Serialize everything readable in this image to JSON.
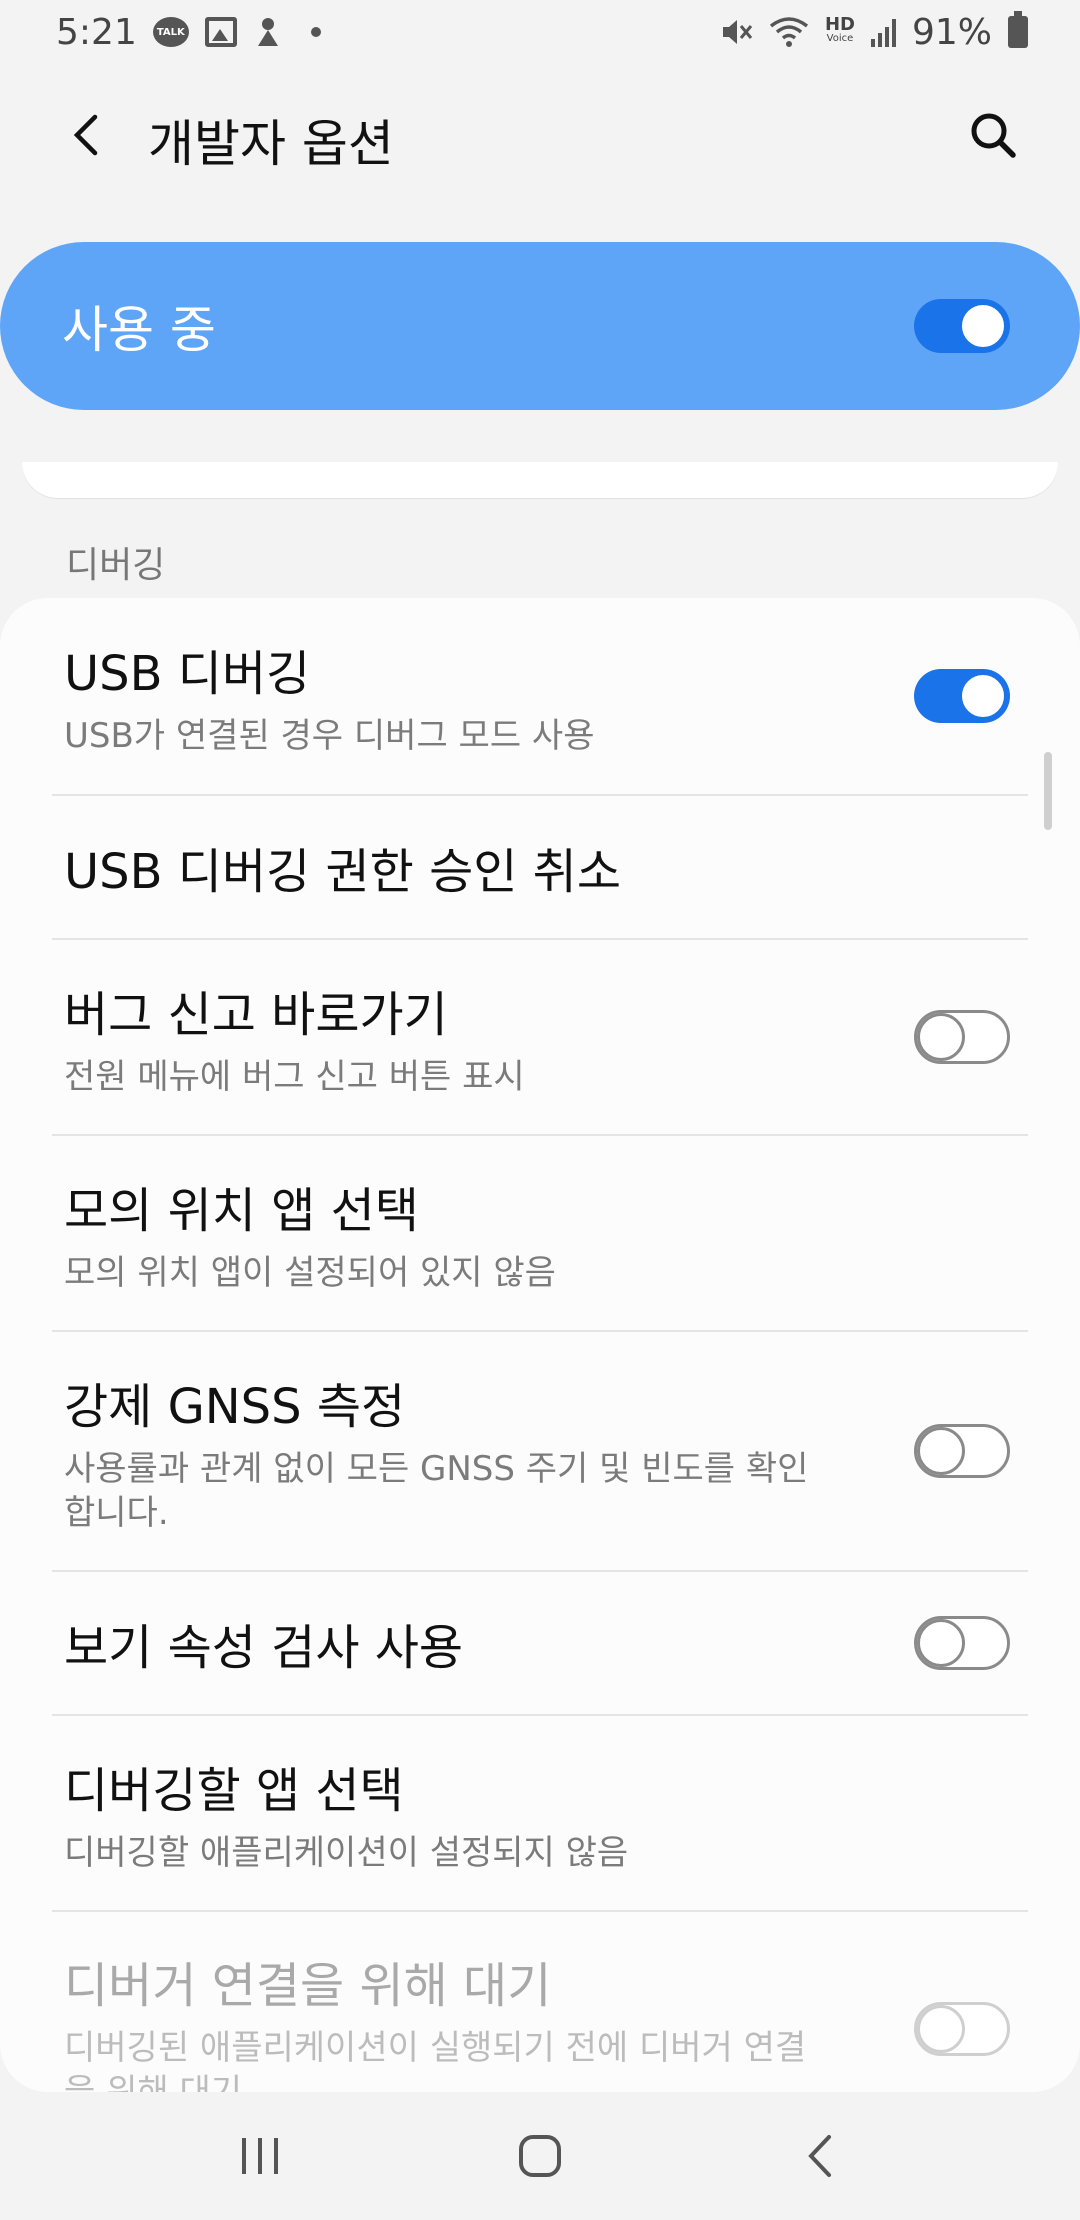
{
  "status_bar": {
    "time": "5:21",
    "talk_label": "TALK",
    "hd_label_top": "HD",
    "hd_label_bottom": "Voice",
    "battery": "91%",
    "icons": [
      "kakaotalk-icon",
      "gallery-icon",
      "download-icon",
      "dot-icon",
      "mute-icon",
      "wifi-icon",
      "hd-voice-icon",
      "signal-icon",
      "battery-icon"
    ]
  },
  "header": {
    "title": "개발자 옵션",
    "back_icon": "chevron-left-icon",
    "search_icon": "search-icon"
  },
  "master": {
    "label": "사용 중",
    "enabled": true
  },
  "section": {
    "title": "디버깅"
  },
  "settings": [
    {
      "title": "USB 디버깅",
      "summary": "USB가 연결된 경우 디버그 모드 사용",
      "toggle": "on"
    },
    {
      "title": "USB 디버깅 권한 승인 취소",
      "summary": "",
      "toggle": "none"
    },
    {
      "title": "버그 신고 바로가기",
      "summary": "전원 메뉴에 버그 신고 버튼 표시",
      "toggle": "off"
    },
    {
      "title": "모의 위치 앱 선택",
      "summary": "모의 위치 앱이 설정되어 있지 않음",
      "toggle": "none"
    },
    {
      "title": "강제 GNSS 측정",
      "summary": "사용률과 관계 없이 모든 GNSS 주기 및 빈도를 확인합니다.",
      "toggle": "off"
    },
    {
      "title": "보기 속성 검사 사용",
      "summary": "",
      "toggle": "off"
    },
    {
      "title": "디버깅할 앱 선택",
      "summary": "디버깅할 애플리케이션이 설정되지 않음",
      "toggle": "none"
    },
    {
      "title": "디버거 연결을 위해 대기",
      "summary": "디버깅된 애플리케이션이 실행되기 전에 디버거 연결을 위해 대기",
      "toggle": "off",
      "disabled": true
    }
  ],
  "nav": {
    "recents_icon": "recents-icon",
    "home_icon": "home-icon",
    "back_icon": "back-icon"
  },
  "colors": {
    "accent": "#1a73e8",
    "banner": "#5ea5f8",
    "background": "#f3f3f3"
  }
}
